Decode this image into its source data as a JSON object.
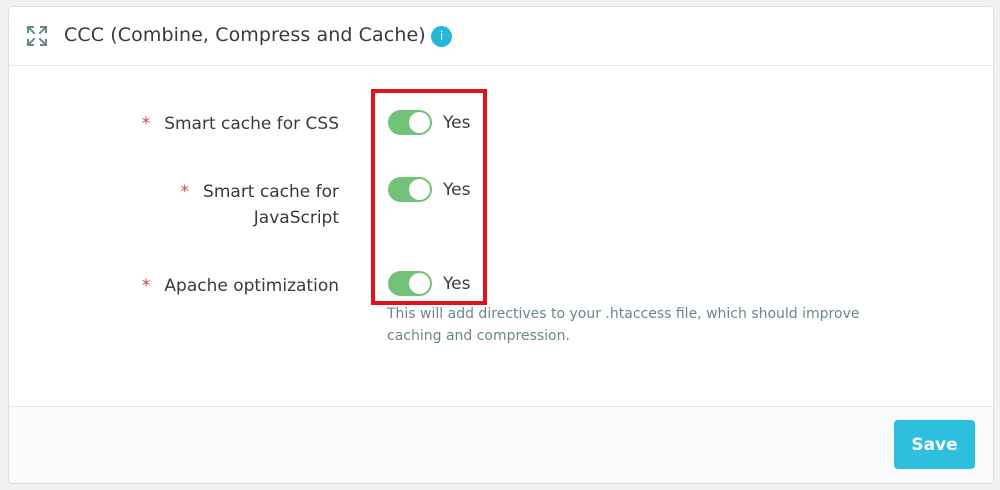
{
  "panel": {
    "title": "CCC (Combine, Compress and Cache)",
    "header_icon": "expand-arrows-icon",
    "info_icon": "info-icon",
    "info_glyph": "i"
  },
  "fields": [
    {
      "required_mark": "*",
      "label": "Smart cache for CSS",
      "value": "Yes",
      "enabled": true
    },
    {
      "required_mark": "*",
      "label_line1": "Smart cache for",
      "label_line2": "JavaScript",
      "value": "Yes",
      "enabled": true
    },
    {
      "required_mark": "*",
      "label": "Apache optimization",
      "value": "Yes",
      "enabled": true,
      "help": "This will add directives to your .htaccess file, which should improve caching and compression."
    }
  ],
  "footer": {
    "save_label": "Save"
  },
  "colors": {
    "accent": "#25b9d7",
    "toggle_on": "#72c279",
    "required": "#d0454c",
    "highlight": "#e0121b"
  }
}
